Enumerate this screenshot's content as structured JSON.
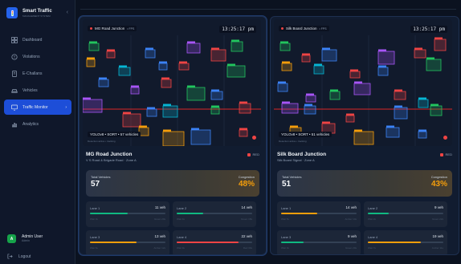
{
  "app": {
    "title": "Smart Traffic",
    "subtitle": "MANAGEMENT SYSTEM",
    "collapse_glyph": "‹"
  },
  "nav": [
    {
      "label": "Dashboard",
      "icon": "grid-icon"
    },
    {
      "label": "Violations",
      "icon": "alert-circle-icon"
    },
    {
      "label": "E-Challans",
      "icon": "receipt-icon"
    },
    {
      "label": "Vehicles",
      "icon": "car-icon"
    },
    {
      "label": "Traffic Monitor",
      "icon": "monitor-icon",
      "active": true,
      "chevron": "›"
    },
    {
      "label": "Analytics",
      "icon": "chart-icon"
    }
  ],
  "user": {
    "initial": "A",
    "name": "Admin User",
    "role": "Admin"
  },
  "logout_label": "Logout",
  "cameras": [
    {
      "feed_label": "MG Road Junction",
      "fps": "• FPS",
      "time": "13:25:17 pm",
      "stats": "YOLOv8 • SORT • 57 vehicles",
      "stats_sub": "Detection active • tracking",
      "location": "MG Road Junction",
      "address": "V S Road & Brigade Road · Zone A",
      "status": "RED",
      "total_label": "Total Vehicles",
      "total": "57",
      "congestion_label": "Congestion",
      "congestion": "48%",
      "lanes": [
        {
          "name": "Lane 1",
          "count": "11 veh",
          "fill": 0.5,
          "color": "#10b981",
          "left": "Wait 3s",
          "right": "Green 20s"
        },
        {
          "name": "Lane 2",
          "count": "14 veh",
          "fill": 0.35,
          "color": "#10b981",
          "left": "Wait 4s",
          "right": "Green 18s"
        },
        {
          "name": "Lane 3",
          "count": "13 veh",
          "fill": 0.62,
          "color": "#f59e0b",
          "left": "Wait 6s",
          "right": "Amber 12s"
        },
        {
          "name": "Lane 4",
          "count": "22 veh",
          "fill": 0.82,
          "color": "#ef4444",
          "left": "Wait 9s",
          "right": "Red 30s"
        }
      ]
    },
    {
      "feed_label": "Silk Board Junction",
      "fps": "• FPS",
      "time": "13:25:17 pm",
      "stats": "YOLOv8 • SORT • 51 vehicles",
      "stats_sub": "Detection active • tracking",
      "location": "Silk Board Junction",
      "address": "Silk Board Signal · Zone A",
      "status": "RED",
      "total_label": "Total Vehicles",
      "total": "51",
      "congestion_label": "Congestion",
      "congestion": "43%",
      "lanes": [
        {
          "name": "Lane 1",
          "count": "14 veh",
          "fill": 0.48,
          "color": "#f59e0b",
          "left": "Wait 5s",
          "right": "Amber 14s"
        },
        {
          "name": "Lane 2",
          "count": "9 veh",
          "fill": 0.28,
          "color": "#10b981",
          "left": "Wait 2s",
          "right": "Green 22s"
        },
        {
          "name": "Lane 3",
          "count": "9 veh",
          "fill": 0.3,
          "color": "#10b981",
          "left": "Wait 3s",
          "right": "Green 20s"
        },
        {
          "name": "Lane 4",
          "count": "19 veh",
          "fill": 0.7,
          "color": "#f59e0b",
          "left": "Wait 7s",
          "right": "Amber 11s"
        }
      ]
    }
  ],
  "colors": {
    "accent": "#1d4ed8",
    "red": "#ef4444",
    "green": "#10b981",
    "amber": "#f59e0b",
    "box_colors": [
      "#22c55e",
      "#ef4444",
      "#3b82f6",
      "#a855f7",
      "#f59e0b",
      "#06b6d4"
    ]
  }
}
